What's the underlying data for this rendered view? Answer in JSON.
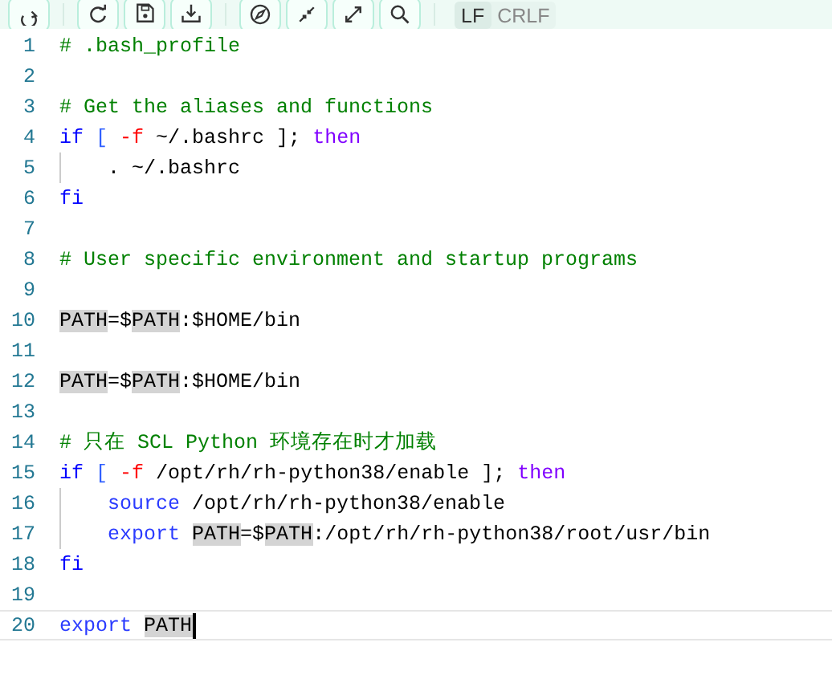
{
  "toolbar": {
    "line_endings": [
      {
        "label": "LF",
        "selected": true
      },
      {
        "label": "CRLF",
        "selected": false
      }
    ]
  },
  "editor": {
    "lines": [
      {
        "number": "1",
        "current": false,
        "indented": false,
        "tokens": [
          {
            "kind": "comment",
            "text": "# .bash_profile"
          }
        ]
      },
      {
        "number": "2",
        "current": false,
        "indented": false
      },
      {
        "number": "3",
        "current": false,
        "indented": false,
        "tokens": [
          {
            "kind": "comment",
            "text": "# Get the aliases and functions"
          }
        ]
      },
      {
        "number": "4",
        "current": false,
        "indented": false,
        "tokens": [
          {
            "kind": "keyword",
            "text": "if "
          },
          {
            "kind": "bracket",
            "text": "[ "
          },
          {
            "kind": "flag",
            "text": "-f"
          },
          {
            "kind": "plain",
            "text": " ~/.bashrc ]; "
          },
          {
            "kind": "operator",
            "text": "then"
          }
        ]
      },
      {
        "number": "5",
        "current": false,
        "indented": true,
        "tokens": [
          {
            "kind": "plain",
            "text": ". ~/.bashrc"
          }
        ]
      },
      {
        "number": "6",
        "current": false,
        "indented": false,
        "tokens": [
          {
            "kind": "keyword",
            "text": "fi"
          }
        ]
      },
      {
        "number": "7",
        "current": false,
        "indented": false
      },
      {
        "number": "8",
        "current": false,
        "indented": false,
        "tokens": [
          {
            "kind": "comment",
            "text": "# User specific environment and startup programs"
          }
        ]
      },
      {
        "number": "9",
        "current": false,
        "indented": false
      },
      {
        "number": "10",
        "current": false,
        "indented": false,
        "tokens": [
          {
            "kind": "match",
            "text": "PATH"
          },
          {
            "kind": "plain",
            "text": "=$"
          },
          {
            "kind": "match",
            "text": "PATH"
          },
          {
            "kind": "plain",
            "text": ":$HOME/bin"
          }
        ]
      },
      {
        "number": "11",
        "current": false,
        "indented": false
      },
      {
        "number": "12",
        "current": false,
        "indented": false,
        "tokens": [
          {
            "kind": "match",
            "text": "PATH"
          },
          {
            "kind": "plain",
            "text": "=$"
          },
          {
            "kind": "match",
            "text": "PATH"
          },
          {
            "kind": "plain",
            "text": ":$HOME/bin"
          }
        ]
      },
      {
        "number": "13",
        "current": false,
        "indented": false
      },
      {
        "number": "14",
        "current": false,
        "indented": false,
        "tokens": [
          {
            "kind": "comment",
            "text": "# 只在 SCL Python 环境存在时才加载"
          }
        ]
      },
      {
        "number": "15",
        "current": false,
        "indented": false,
        "tokens": [
          {
            "kind": "keyword",
            "text": "if "
          },
          {
            "kind": "bracket",
            "text": "[ "
          },
          {
            "kind": "flag",
            "text": "-f"
          },
          {
            "kind": "plain",
            "text": " /opt/rh/rh-python38/enable ]; "
          },
          {
            "kind": "operator",
            "text": "then"
          }
        ]
      },
      {
        "number": "16",
        "current": false,
        "indented": true,
        "tokens": [
          {
            "kind": "builtin",
            "text": "source"
          },
          {
            "kind": "plain",
            "text": " /opt/rh/rh-python38/enable"
          }
        ]
      },
      {
        "number": "17",
        "current": false,
        "indented": true,
        "tokens": [
          {
            "kind": "builtin",
            "text": "export "
          },
          {
            "kind": "match",
            "text": "PATH"
          },
          {
            "kind": "plain",
            "text": "=$"
          },
          {
            "kind": "match",
            "text": "PATH"
          },
          {
            "kind": "plain",
            "text": ":/opt/rh/rh-python38/root/usr/bin"
          }
        ]
      },
      {
        "number": "18",
        "current": false,
        "indented": false,
        "tokens": [
          {
            "kind": "keyword",
            "text": "fi"
          }
        ]
      },
      {
        "number": "19",
        "current": false,
        "indented": false
      },
      {
        "number": "20",
        "current": true,
        "indented": false,
        "tokens": [
          {
            "kind": "builtin",
            "text": "export "
          },
          {
            "kind": "match",
            "text": "PATH"
          }
        ]
      }
    ]
  }
}
